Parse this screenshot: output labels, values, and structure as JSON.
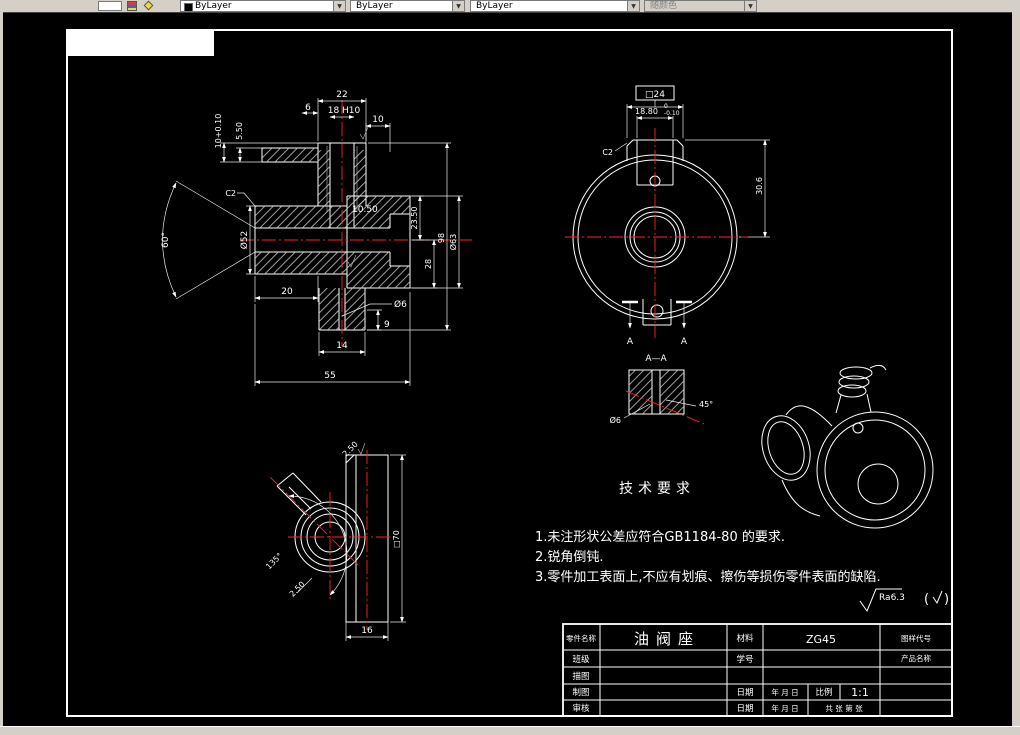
{
  "toolbar": {
    "color": "ByLayer",
    "linetype": "ByLayer",
    "lineweight": "ByLayer",
    "plot_style": "随颜色"
  },
  "icons": {
    "combo_arrow": "▼"
  },
  "views": {
    "front": {
      "d22": "22",
      "d6": "6",
      "d18": "18 H10",
      "d10": "10",
      "d10tol": "10+0.10",
      "d550": "5.50",
      "d52": "Ø52",
      "a60": "60°",
      "c2": "C2",
      "d20": "20",
      "d55": "55",
      "d14": "14",
      "d9": "9",
      "dia6": "Ø6",
      "d1050": "10.50",
      "d2350": "23.50",
      "d28": "28",
      "d98": "98",
      "d63": "Ø63"
    },
    "side": {
      "d24": "□24",
      "d1880": "18.80",
      "tol_up": "0",
      "tol_dn": "-0.10",
      "c2": "C2",
      "d306": "30.6",
      "a_left": "A",
      "a_right": "A"
    },
    "section": {
      "title": "A—A",
      "dia6": "Ø6",
      "a45": "45°"
    },
    "bottom": {
      "d250a": "2.50",
      "a135": "135°",
      "d250b": "2.50",
      "d16": "16",
      "d70": "□70"
    }
  },
  "tech": {
    "title": "技术要求",
    "items": [
      "1.未注形状公差应符合GB1184-80 的要求.",
      "2.锐角倒钝.",
      "3.零件加工表面上,不应有划痕、擦伤等损伤零件表面的缺陷."
    ],
    "ra": "Ra6.3",
    "paren_open": "(",
    "paren_close": ")"
  },
  "titleblock": {
    "part_name_label": "零件名称",
    "part_name": "油阀座",
    "material_label": "材料",
    "material": "ZG45",
    "drawing_no_label": "图样代号",
    "product_name_label": "产品名称",
    "class_label": "班级",
    "student_id_label": "学号",
    "tracing_label": "描图",
    "drafting_label": "制图",
    "audit_label": "审核",
    "date_label_1": "日期",
    "date_value_1": "年 月 日",
    "scale_label": "比例",
    "scale_value": "1:1",
    "date_label_2": "日期",
    "date_value_2": "年 月 日",
    "sheet_info": "共 张 第 张"
  },
  "colors": {
    "canvas": "#000000",
    "lines": "#ffffff",
    "centerline": "#ff2222",
    "chrome": "#d4d0c8"
  }
}
